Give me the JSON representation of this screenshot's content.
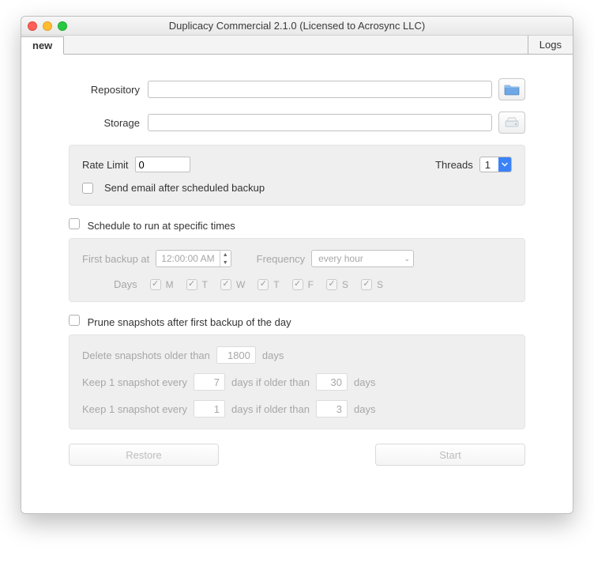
{
  "window": {
    "title": "Duplicacy Commercial 2.1.0 (Licensed to Acrosync LLC)"
  },
  "tabs": {
    "new": "new",
    "logs": "Logs"
  },
  "repo": {
    "label": "Repository",
    "value": ""
  },
  "storage": {
    "label": "Storage",
    "value": ""
  },
  "rate": {
    "label": "Rate Limit",
    "value": "0",
    "threads_label": "Threads",
    "threads_value": "1",
    "email_label": "Send email after scheduled backup"
  },
  "schedule": {
    "checkbox_label": "Schedule to run at specific times",
    "first_label": "First backup at",
    "first_value": "12:00:00 AM",
    "freq_label": "Frequency",
    "freq_value": "every hour",
    "days_label": "Days",
    "days": [
      "M",
      "T",
      "W",
      "T",
      "F",
      "S",
      "S"
    ]
  },
  "prune": {
    "checkbox_label": "Prune snapshots after first backup of the day",
    "r1_pre": "Delete snapshots older than",
    "r1_val": "1800",
    "r1_post": "days",
    "r2_pre": "Keep 1 snapshot every",
    "r2_val1": "7",
    "r2_mid": "days if older than",
    "r2_val2": "30",
    "r2_post": "days",
    "r3_pre": "Keep 1 snapshot every",
    "r3_val1": "1",
    "r3_mid": "days if older than",
    "r3_val2": "3",
    "r3_post": "days"
  },
  "buttons": {
    "restore": "Restore",
    "start": "Start"
  }
}
